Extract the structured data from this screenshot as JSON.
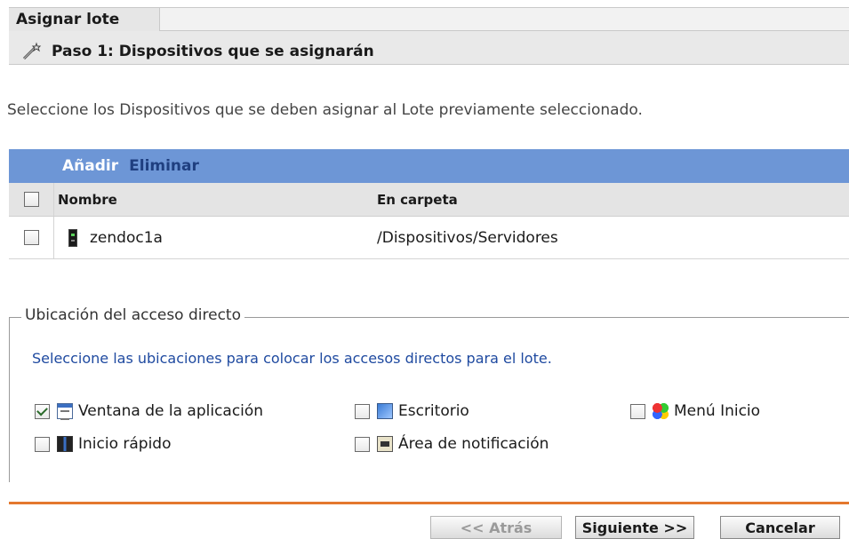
{
  "header": {
    "tab_label": "Asignar lote",
    "step_title": "Paso 1: Dispositivos que se asignarán",
    "step_icon": "wand-icon"
  },
  "intro_text": "Seleccione los Dispositivos que se deben asignar al Lote previamente seleccionado.",
  "table": {
    "toolbar": {
      "add_label": "Añadir",
      "remove_label": "Eliminar"
    },
    "columns": {
      "name": "Nombre",
      "folder": "En carpeta"
    },
    "rows": [
      {
        "name": "zendoc1a",
        "folder": "/Dispositivos/Servidores",
        "icon": "server-icon",
        "checked": false
      }
    ]
  },
  "shortcuts": {
    "legend": "Ubicación del acceso directo",
    "description": "Seleccione las ubicaciones para colocar los accesos directos para el lote.",
    "options": [
      {
        "label": "Ventana de la aplicación",
        "checked": true,
        "icon": "app-window-icon"
      },
      {
        "label": "Escritorio",
        "checked": false,
        "icon": "desktop-icon"
      },
      {
        "label": "Menú Inicio",
        "checked": false,
        "icon": "start-menu-icon"
      },
      {
        "label": "Inicio rápido",
        "checked": false,
        "icon": "quick-launch-icon"
      },
      {
        "label": "Área de notificación",
        "checked": false,
        "icon": "system-tray-icon"
      }
    ]
  },
  "footer": {
    "back_label": "<< Atrás",
    "next_label": "Siguiente >>",
    "cancel_label": "Cancelar",
    "accent_color": "#e4782e"
  }
}
